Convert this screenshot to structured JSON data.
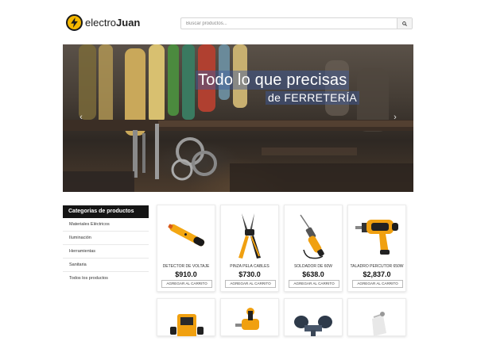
{
  "brand": {
    "name_light": "electro",
    "name_bold": "Juan"
  },
  "search": {
    "placeholder": "Buscar productos..."
  },
  "hero": {
    "line1": "Todo lo que precisas",
    "line2": "de FERRETERÍA",
    "prev": "‹",
    "next": "›"
  },
  "sidebar": {
    "title": "Categorias de productos",
    "items": [
      {
        "label": "Materiales Eléctricos"
      },
      {
        "label": "Iluminación"
      },
      {
        "label": "Herramientas"
      },
      {
        "label": "Sanitaria"
      },
      {
        "label": "Todos los productos"
      }
    ]
  },
  "products": [
    {
      "name": "DETECTOR DE VOLTAJE",
      "price": "$910.0",
      "button": "AGREGAR AL CARRITO",
      "icon": "voltage-detector-icon"
    },
    {
      "name": "PINZA PELA CABLES",
      "price": "$730.0",
      "button": "AGREGAR AL CARRITO",
      "icon": "wire-stripper-icon"
    },
    {
      "name": "SOLDADOR DE 60W",
      "price": "$638.0",
      "button": "AGREGAR AL CARRITO",
      "icon": "soldering-iron-icon"
    },
    {
      "name": "TALADRO PERCUTOR 650W",
      "price": "$2,837.0",
      "button": "AGREGAR AL CARRITO",
      "icon": "impact-drill-icon"
    }
  ],
  "products_row2": [
    {
      "icon": "multimeter-icon"
    },
    {
      "icon": "cordless-drill-icon"
    },
    {
      "icon": "faucet-icon"
    },
    {
      "icon": "lamp-icon"
    }
  ],
  "colors": {
    "brand_yellow": "#f5b800",
    "sidebar_header": "#151515",
    "hero_text_highlight": "#3c5aa0"
  }
}
